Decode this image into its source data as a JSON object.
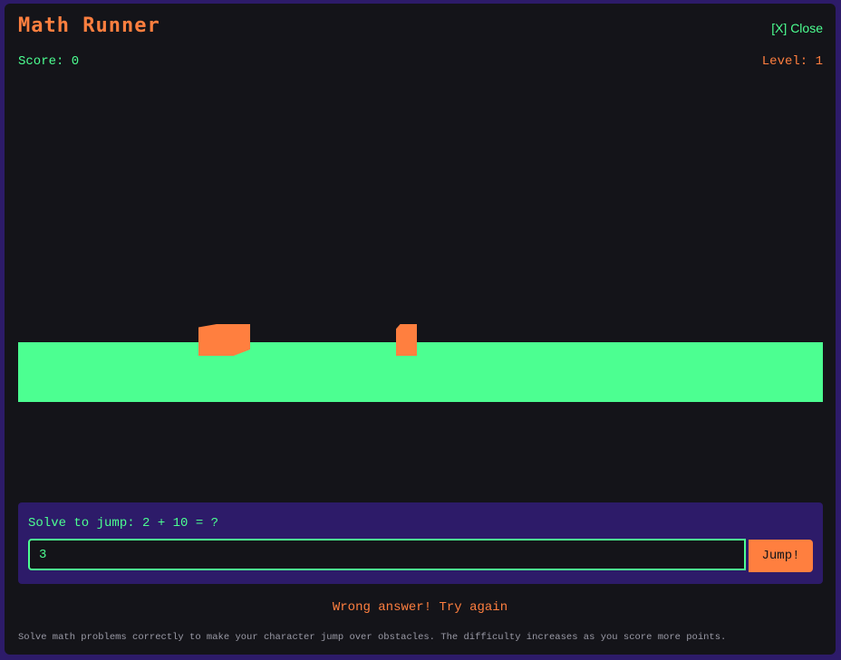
{
  "header": {
    "title": "Math Runner",
    "close_label": "[X] Close"
  },
  "stats": {
    "score_text": "Score: 0",
    "level_text": "Level: 1"
  },
  "question": {
    "prompt": "Solve to jump: 2 + 10 = ?",
    "answer_value": "3",
    "jump_label": "Jump!"
  },
  "feedback": "Wrong answer! Try again",
  "help_text": "Solve math problems correctly to make your character jump over obstacles. The difficulty increases as you score more points.",
  "colors": {
    "background": "#141419",
    "border": "#2d1b69",
    "accent_orange": "#ff7f3f",
    "accent_green": "#4cff91"
  }
}
